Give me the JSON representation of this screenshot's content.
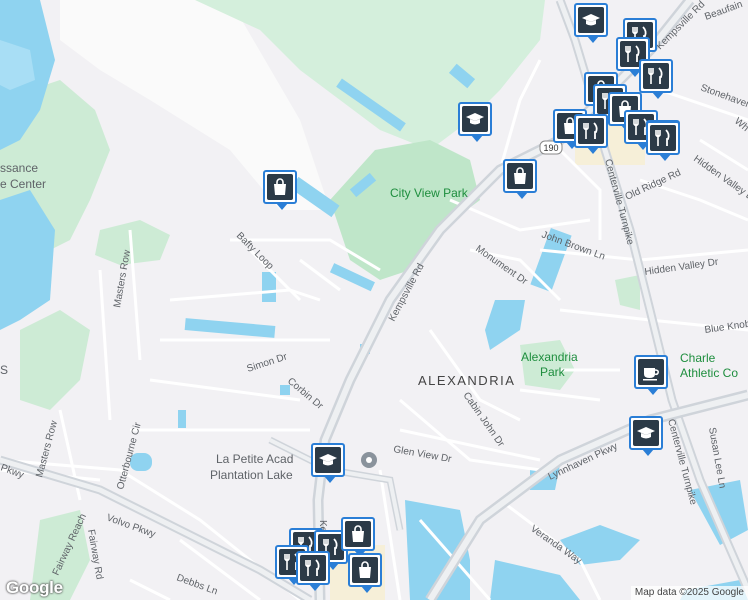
{
  "map": {
    "labels": {
      "city_view_park": "City View Park",
      "alexandria_park_1": "Alexandria",
      "alexandria_park_2": "Park",
      "alexandria_area": "ALEXANDRIA",
      "renaissance_1": "ssance",
      "renaissance_2": "e Center",
      "la_petite_1": "La Petite Acad",
      "la_petite_2": "Plantation Lake",
      "charle_1": "Charle",
      "charle_2": "Athletic Co",
      "left_s": "S",
      "kempsville_rd": "Kempsville Rd",
      "kempsville_rd_short": "Ken",
      "centerville_tpk_upper": "Centerville Turnpike",
      "centerville_tpk_lower": "Centerville Turnpike",
      "kempsville_rd_top": "Kempsville Rd",
      "beaufain": "Beaufain",
      "stonehaven": "Stonehaven",
      "wh": "Wh",
      "hidden_valley_dr_1": "Hidden Valley Dr",
      "hidden_valley_dr_2": "Hidden Valley Dr",
      "old_ridge_rd": "Old Ridge Rd",
      "john_brown_ln": "John Brown Ln",
      "monument_dr": "Monument Dr",
      "blue_knob": "Blue Knob",
      "bafty_loop": "Bafty Loop",
      "masters_row_1": "Masters Row",
      "masters_row_2": "Masters Row",
      "simon_dr": "Simon Dr",
      "corbin_dr": "Corbin Dr",
      "cabin_john_dr": "Cabin John Dr",
      "glen_view_dr": "Glen View Dr",
      "lynnhaven_pkwy": "Lynnhaven Pkwy",
      "susan_lee_ln": "Susan Lee Ln",
      "veranda_way": "Veranda Way",
      "otterbourne_cir": "Otterbourne Cir",
      "volvo_pkwy": "Volvo Pkwy",
      "pkwy_left": "Pkwy",
      "fairway_reach": "Fairway Reach",
      "fairway_rd": "Fairway Rd",
      "debbs_ln": "Debbs Ln",
      "route_190": "190"
    },
    "markers": [
      {
        "type": "shopping",
        "icon": "shopping-bag-icon"
      },
      {
        "type": "school",
        "icon": "graduation-cap-icon"
      },
      {
        "type": "shopping",
        "icon": "shopping-bag-icon"
      },
      {
        "type": "school",
        "icon": "graduation-cap-icon"
      },
      {
        "type": "restaurant",
        "icon": "fork-knife-icon"
      },
      {
        "type": "restaurant",
        "icon": "fork-knife-icon"
      },
      {
        "type": "shopping",
        "icon": "shopping-bag-icon"
      },
      {
        "type": "restaurant",
        "icon": "fork-knife-icon"
      },
      {
        "type": "restaurant",
        "icon": "fork-knife-icon"
      },
      {
        "type": "shopping",
        "icon": "shopping-bag-icon"
      },
      {
        "type": "shopping",
        "icon": "shopping-bag-icon"
      },
      {
        "type": "restaurant",
        "icon": "fork-knife-icon"
      },
      {
        "type": "restaurant",
        "icon": "fork-knife-icon"
      },
      {
        "type": "restaurant",
        "icon": "fork-knife-icon"
      },
      {
        "type": "restaurant",
        "icon": "fork-knife-icon"
      },
      {
        "type": "cafe",
        "icon": "coffee-cup-icon"
      },
      {
        "type": "school",
        "icon": "graduation-cap-icon"
      },
      {
        "type": "school",
        "icon": "graduation-cap-icon"
      },
      {
        "type": "restaurant",
        "icon": "fork-knife-icon"
      },
      {
        "type": "restaurant",
        "icon": "fork-knife-icon"
      },
      {
        "type": "shopping",
        "icon": "shopping-bag-icon"
      },
      {
        "type": "restaurant",
        "icon": "fork-knife-icon"
      },
      {
        "type": "restaurant",
        "icon": "fork-knife-icon"
      },
      {
        "type": "shopping",
        "icon": "shopping-bag-icon"
      }
    ],
    "colors": {
      "background": "#f2f1f4",
      "water": "#8fd3f0",
      "park": "#c8ebd2",
      "road": "#ffffff",
      "highway": "#dfe2e6",
      "marker_border": "#2a7ed6",
      "marker_fill": "#2b3a47"
    }
  },
  "attribution": "Map data ©2025 Google",
  "logo": "Google"
}
